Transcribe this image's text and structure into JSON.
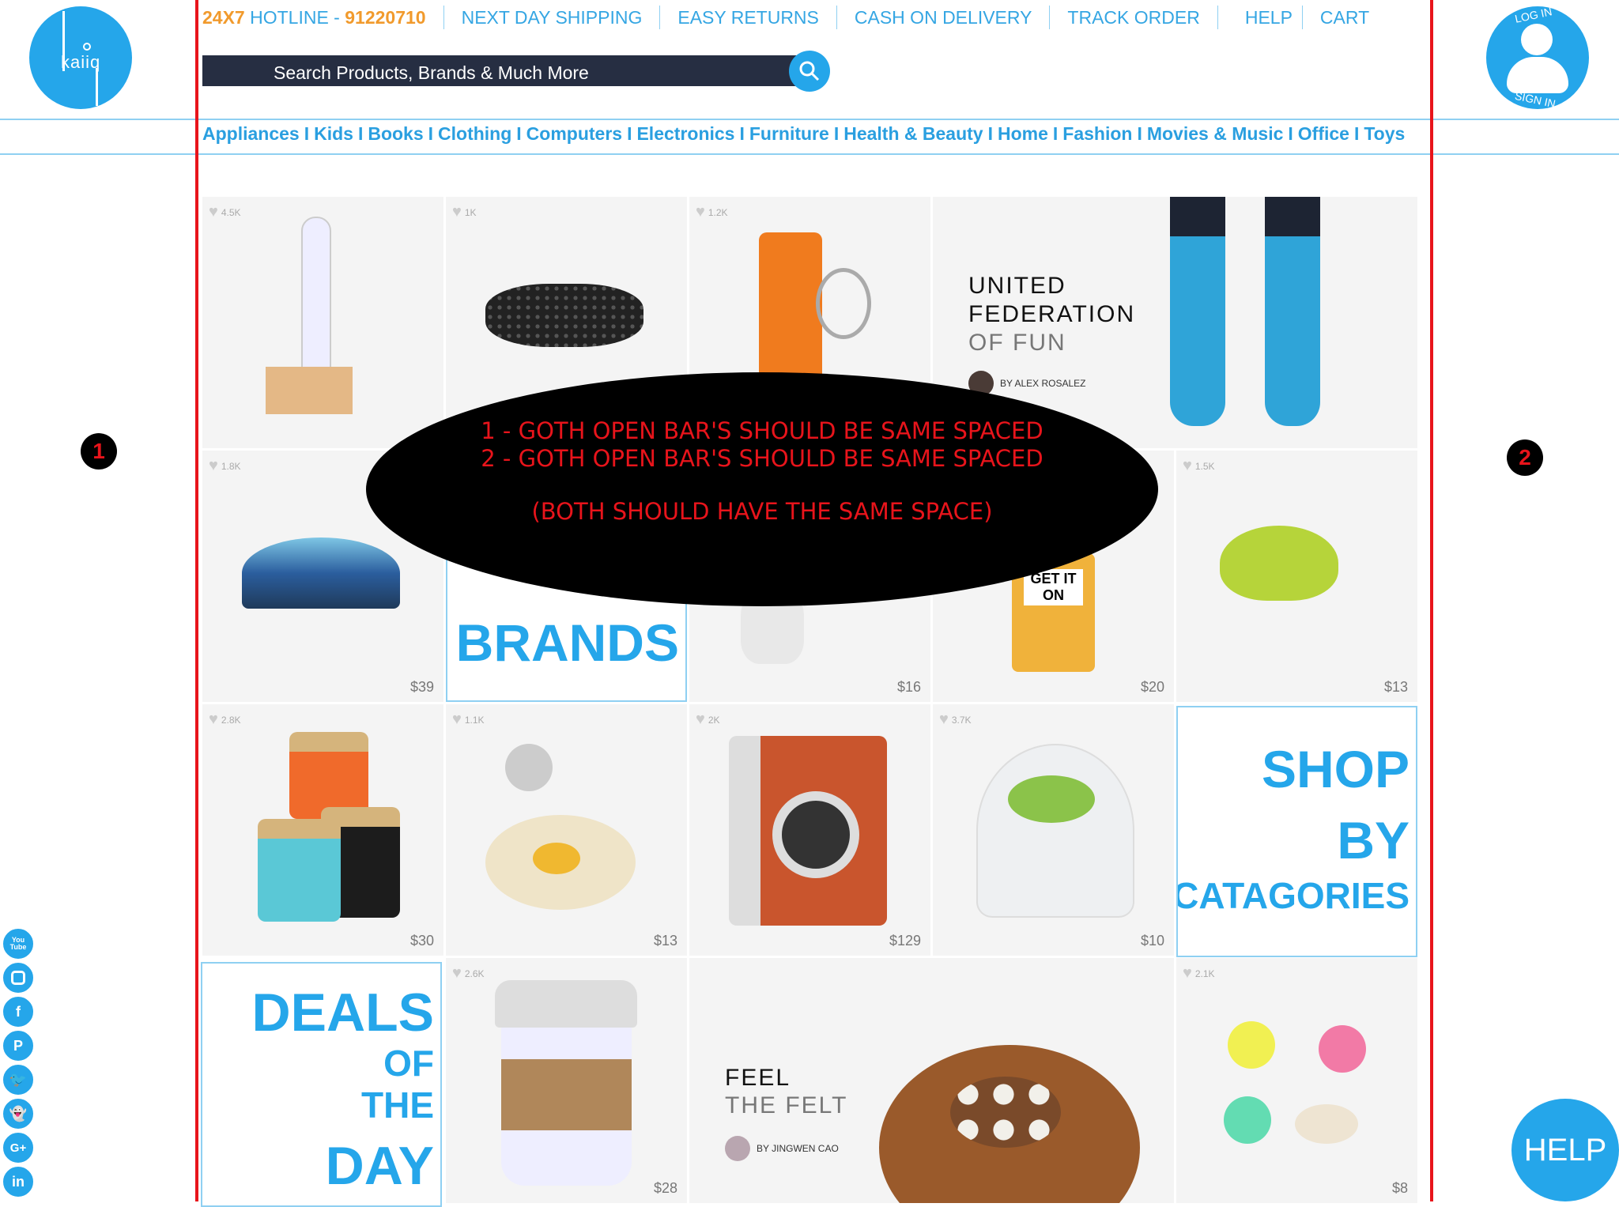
{
  "logo": {
    "text": "kaiiq"
  },
  "topnav": {
    "hotline_prefix": "24X7",
    "hotline_label": " HOTLINE - ",
    "hotline_number": "91220710",
    "items": [
      "NEXT DAY SHIPPING",
      "EASY RETURNS",
      "CASH ON DELIVERY",
      "TRACK ORDER",
      "HELP",
      "CART"
    ]
  },
  "search": {
    "placeholder": "Search Products, Brands & Much More"
  },
  "login": {
    "top": "LOG IN",
    "bottom": "SIGN IN"
  },
  "categories": [
    "Appliances",
    "Kids",
    "Books",
    "Clothing",
    "Computers",
    "Electronics",
    "Furniture",
    "Health & Beauty",
    "Home",
    "Fashion",
    "Movies & Music",
    "Office",
    "Toys"
  ],
  "category_separator": "I",
  "products": [
    {
      "likes": "4.5K",
      "price": ""
    },
    {
      "likes": "1K",
      "price": ""
    },
    {
      "likes": "1.2K",
      "price": ""
    },
    {
      "likes": "1.8K",
      "price": "$39"
    },
    {
      "likes": "",
      "price": "$16"
    },
    {
      "likes": "",
      "price": "$20",
      "label": "GET IT ON"
    },
    {
      "likes": "1.5K",
      "price": "$13"
    },
    {
      "likes": "2.8K",
      "price": "$30"
    },
    {
      "likes": "1.1K",
      "price": "$13"
    },
    {
      "likes": "2K",
      "price": "$129"
    },
    {
      "likes": "3.7K",
      "price": "$10"
    },
    {
      "likes": "2.6K",
      "price": "$28"
    },
    {
      "likes": "2.1K",
      "price": "$8"
    }
  ],
  "feature1": {
    "line1": "UNITED",
    "line2": "FEDERATION",
    "line3": "OF FUN",
    "author": "BY ALEX ROSALEZ"
  },
  "feature2": {
    "line1": "FEEL",
    "line2": "THE FELT",
    "author": "BY JINGWEN CAO"
  },
  "promos": {
    "brands": "BRANDS",
    "shop": [
      "SHOP",
      "BY",
      "CATAGORIES"
    ],
    "deals": [
      "DEALS",
      "OF",
      "THE",
      "DAY"
    ]
  },
  "annotation": {
    "line1": "1 - GOTH OPEN BAR'S SHOULD BE SAME SPACED",
    "line2": "2 - GOTH OPEN BAR'S SHOULD BE SAME SPACED",
    "line3": "(BOTH SHOULD HAVE THE SAME SPACE)",
    "marker1": "1",
    "marker2": "2"
  },
  "social": [
    "You Tube",
    "Instagram",
    "f",
    "P",
    "Twitter",
    "Snapchat",
    "G+",
    "in"
  ],
  "help_button": "HELP",
  "colors": {
    "brand": "#25a6ea",
    "accent": "#f19a2c",
    "annotation": "#e8141b"
  }
}
